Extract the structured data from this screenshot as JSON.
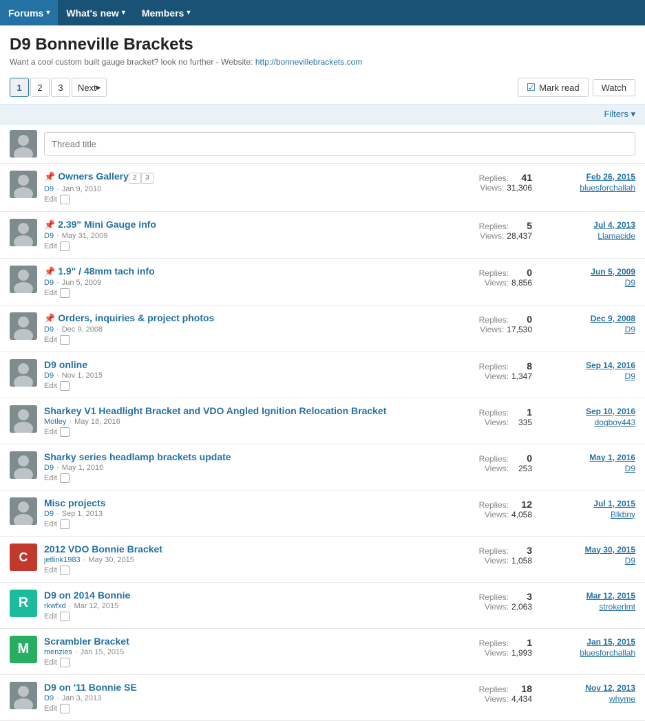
{
  "nav": {
    "items": [
      {
        "label": "Forums",
        "active": true,
        "hasDropdown": true
      },
      {
        "label": "What's new",
        "active": false,
        "hasDropdown": true
      },
      {
        "label": "Members",
        "active": false,
        "hasDropdown": true
      }
    ]
  },
  "page": {
    "title": "D9 Bonneville Brackets",
    "subtitle": "Want a cool custom built gauge bracket? look no further - Website: http://bonnevillebrackets.com",
    "subtitle_link": "http://bonnevillebrackets.com",
    "subtitle_link_text": "http://bonnevillebrackets.com"
  },
  "pagination": {
    "pages": [
      "1",
      "2",
      "3"
    ],
    "active": "1",
    "next_label": "Next"
  },
  "actions": {
    "mark_read_label": "Mark read",
    "watch_label": "Watch"
  },
  "filters": {
    "label": "Filters"
  },
  "new_thread": {
    "placeholder": "Thread title"
  },
  "threads": [
    {
      "id": 1,
      "title": "Owners Gallery",
      "author": "D9",
      "date": "Jan 9, 2010",
      "pinned": true,
      "pages": [
        "2",
        "3"
      ],
      "replies": 41,
      "views": "31,306",
      "last_date": "Feb 26, 2015",
      "last_user": "bluesforchallah",
      "avatar_type": "img",
      "avatar_color": "av-grey",
      "avatar_letter": ""
    },
    {
      "id": 2,
      "title": "2.39\" Mini Gauge info",
      "author": "D9",
      "date": "May 31, 2009",
      "pinned": true,
      "pages": [],
      "replies": 5,
      "views": "28,437",
      "last_date": "Jul 4, 2013",
      "last_user": "Llamacide",
      "avatar_type": "img",
      "avatar_color": "av-grey",
      "avatar_letter": ""
    },
    {
      "id": 3,
      "title": "1.9\" / 48mm tach info",
      "author": "D9",
      "date": "Jun 5, 2009",
      "pinned": true,
      "pages": [],
      "replies": 0,
      "views": "8,856",
      "last_date": "Jun 5, 2009",
      "last_user": "D9",
      "avatar_type": "img",
      "avatar_color": "av-grey",
      "avatar_letter": ""
    },
    {
      "id": 4,
      "title": "Orders, inquiries & project photos",
      "author": "D9",
      "date": "Dec 9, 2008",
      "pinned": true,
      "pages": [],
      "replies": 0,
      "views": "17,530",
      "last_date": "Dec 9, 2008",
      "last_user": "D9",
      "avatar_type": "img",
      "avatar_color": "av-grey",
      "avatar_letter": ""
    },
    {
      "id": 5,
      "title": "D9 online",
      "author": "D9",
      "date": "Nov 1, 2015",
      "pinned": false,
      "pages": [],
      "replies": 8,
      "views": "1,347",
      "last_date": "Sep 14, 2016",
      "last_user": "D9",
      "avatar_type": "img",
      "avatar_color": "av-grey",
      "avatar_letter": ""
    },
    {
      "id": 6,
      "title": "Sharkey V1 Headlight Bracket and VDO Angled Ignition Relocation Bracket",
      "author": "Motley",
      "date": "May 18, 2016",
      "pinned": false,
      "pages": [],
      "replies": 1,
      "views": "335",
      "last_date": "Sep 10, 2016",
      "last_user": "dogboy443",
      "avatar_type": "img",
      "avatar_color": "av-dark",
      "avatar_letter": ""
    },
    {
      "id": 7,
      "title": "Sharky series headlamp brackets update",
      "author": "D9",
      "date": "May 1, 2016",
      "pinned": false,
      "pages": [],
      "replies": 0,
      "views": "253",
      "last_date": "May 1, 2016",
      "last_user": "D9",
      "avatar_type": "img",
      "avatar_color": "av-grey",
      "avatar_letter": ""
    },
    {
      "id": 8,
      "title": "Misc projects",
      "author": "D9",
      "date": "Sep 1, 2013",
      "pinned": false,
      "pages": [],
      "replies": 12,
      "views": "4,058",
      "last_date": "Jul 1, 2015",
      "last_user": "Blkbny",
      "avatar_type": "img",
      "avatar_color": "av-grey",
      "avatar_letter": ""
    },
    {
      "id": 9,
      "title": "2012 VDO Bonnie Bracket",
      "author": "jetlink1983",
      "date": "May 30, 2015",
      "pinned": false,
      "pages": [],
      "replies": 3,
      "views": "1,058",
      "last_date": "May 30, 2015",
      "last_user": "D9",
      "avatar_type": "chicago",
      "avatar_color": "av-chicago",
      "avatar_letter": ""
    },
    {
      "id": 10,
      "title": "D9 on 2014 Bonnie",
      "author": "rkwfxd",
      "date": "Mar 12, 2015",
      "pinned": false,
      "pages": [],
      "replies": 3,
      "views": "2,063",
      "last_date": "Mar 12, 2015",
      "last_user": "strokerlmt",
      "avatar_type": "R",
      "avatar_color": "av-teal",
      "avatar_letter": "R"
    },
    {
      "id": 11,
      "title": "Scrambler Bracket",
      "author": "menzies",
      "date": "Jan 15, 2015",
      "pinned": false,
      "pages": [],
      "replies": 1,
      "views": "1,993",
      "last_date": "Jan 15, 2015",
      "last_user": "bluesforchallah",
      "avatar_type": "M",
      "avatar_color": "av-green",
      "avatar_letter": "M"
    },
    {
      "id": 12,
      "title": "D9 on '11 Bonnie SE",
      "author": "D9",
      "date": "Jan 3, 2013",
      "pinned": false,
      "pages": [],
      "replies": 18,
      "views": "4,434",
      "last_date": "Nov 12, 2013",
      "last_user": "whyme",
      "avatar_type": "img",
      "avatar_color": "av-grey",
      "avatar_letter": ""
    }
  ],
  "labels": {
    "replies": "Replies:",
    "views": "Views:",
    "edit": "Edit"
  }
}
